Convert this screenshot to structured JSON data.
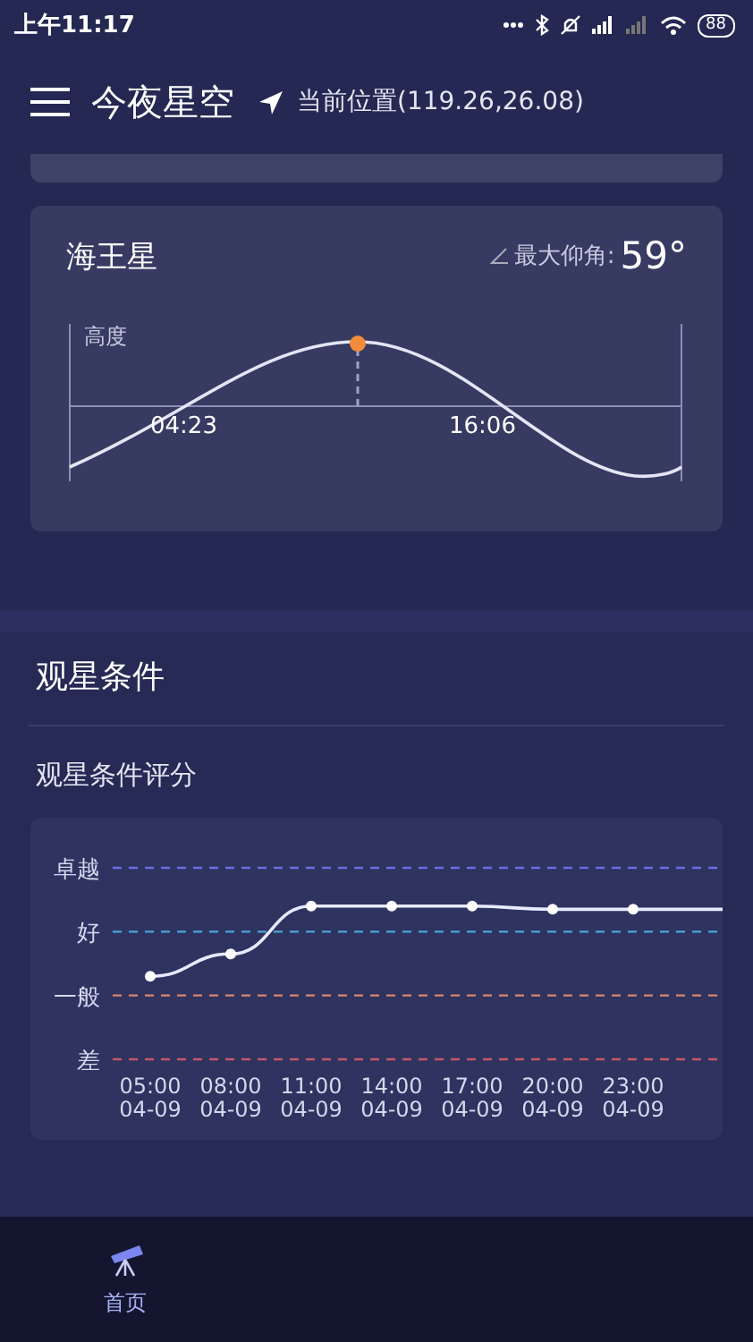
{
  "status_bar": {
    "time": "上午11:17",
    "battery": "88"
  },
  "header": {
    "title": "今夜星空",
    "location": "当前位置(119.26,26.08)"
  },
  "planet_card": {
    "name": "海王星",
    "max_altitude_label": "最大仰角:",
    "max_altitude": "59°",
    "axis_label": "高度",
    "rise_time": "04:23",
    "set_time": "16:06"
  },
  "conditions": {
    "title": "观星条件",
    "subtitle": "观星条件评分",
    "rating_levels": [
      "卓越",
      "好",
      "一般",
      "差"
    ],
    "time_labels": [
      {
        "time": "05:00",
        "date": "04-09"
      },
      {
        "time": "08:00",
        "date": "04-09"
      },
      {
        "time": "11:00",
        "date": "04-09"
      },
      {
        "time": "14:00",
        "date": "04-09"
      },
      {
        "time": "17:00",
        "date": "04-09"
      },
      {
        "time": "20:00",
        "date": "04-09"
      },
      {
        "time": "23:00",
        "date": "04-09"
      }
    ]
  },
  "bottom_nav": [
    {
      "label": "首页",
      "selected": true
    }
  ]
}
